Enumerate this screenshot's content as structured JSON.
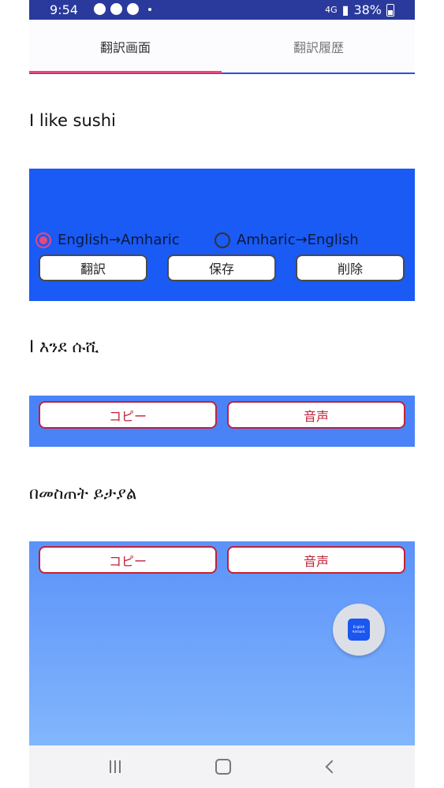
{
  "status": {
    "time": "9:54",
    "network": "4G",
    "battery": "38%"
  },
  "tabs": [
    {
      "label": "翻訳画面"
    },
    {
      "label": "翻訳履歴"
    }
  ],
  "source_text": "I like sushi",
  "direction": {
    "option1": "English→Amharic",
    "option2": "Amharic→English",
    "selected": "English→Amharic"
  },
  "actions": {
    "translate": "翻訳",
    "save": "保存",
    "delete": "削除"
  },
  "result1": {
    "text": "I እንደ ሱሺ",
    "copy": "コピー",
    "speak": "音声"
  },
  "result2": {
    "text": "በመስጠት ይታያል",
    "copy": "コピー",
    "speak": "音声"
  },
  "fab": {
    "line1": "English",
    "line2": "Amharic"
  },
  "colors": {
    "primary_blue": "#1a5af5",
    "accent_pink": "#e8487a",
    "button_red": "#c0223a"
  }
}
